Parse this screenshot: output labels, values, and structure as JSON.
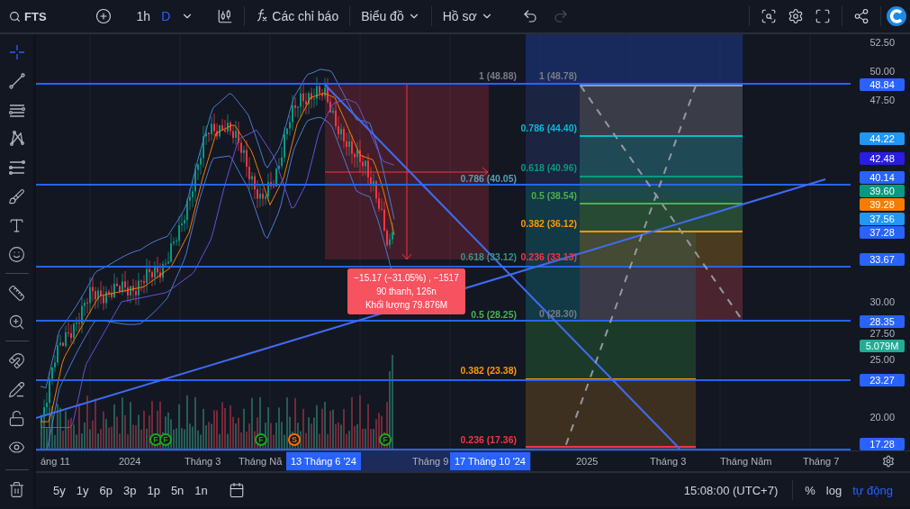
{
  "toolbar": {
    "symbol": "FTS",
    "intervals": [
      {
        "label": "1h",
        "selected": false
      },
      {
        "label": "D",
        "selected": true
      }
    ],
    "indicators_label": "Các chỉ báo",
    "chart_menu": "Biểu đồ",
    "profile_menu": "Hồ sơ",
    "redo_disabled": true
  },
  "drawing_tools": [
    {
      "kind": "crosshair",
      "selected": true
    },
    {
      "kind": "trend",
      "selected": false
    },
    {
      "kind": "channel",
      "selected": false
    },
    {
      "kind": "pattern",
      "selected": false
    },
    {
      "kind": "fib",
      "selected": false
    },
    {
      "kind": "brush",
      "selected": false
    },
    {
      "kind": "text",
      "selected": false
    },
    {
      "kind": "emoji",
      "selected": false
    },
    {
      "kind": "ruler",
      "selected": false
    },
    {
      "kind": "zoom",
      "selected": false
    },
    {
      "kind": "magnet",
      "selected": false
    },
    {
      "kind": "lockdraw",
      "selected": false
    },
    {
      "kind": "lock",
      "selected": false
    },
    {
      "kind": "eye",
      "selected": false
    }
  ],
  "price_axis": {
    "ticks": [
      "52.50",
      "50.00",
      "47.50",
      "30.00",
      "27.50",
      "25.00",
      "20.00"
    ],
    "badges": [
      {
        "value": "48.84",
        "color": "#2962ff"
      },
      {
        "value": "44.22",
        "color": "#2196f3"
      },
      {
        "value": "42.48",
        "color": "#2a1de0"
      },
      {
        "value": "40.14",
        "color": "#2962ff"
      },
      {
        "value": "39.60",
        "color": "#089981"
      },
      {
        "value": "39.28",
        "color": "#f57c00"
      },
      {
        "value": "37.56",
        "color": "#2196f3"
      },
      {
        "value": "37.28",
        "color": "#2962ff"
      },
      {
        "value": "33.67",
        "color": "#2962ff"
      },
      {
        "value": "28.35",
        "color": "#2962ff"
      },
      {
        "value": "5.079M",
        "color": "#22ab94"
      },
      {
        "value": "23.27",
        "color": "#2962ff"
      },
      {
        "value": "17.28",
        "color": "#2962ff"
      }
    ]
  },
  "fib_labels": [
    {
      "text": "1 (48.88)",
      "color": "#787b86"
    },
    {
      "text": "0.786 (40.05)",
      "color": "#5b9cb6"
    },
    {
      "text": "0.618 (33.12)",
      "color": "#3d8f86"
    },
    {
      "text": "0.5 (28.25)",
      "color": "#4caf50"
    },
    {
      "text": "0.382 (23.38)",
      "color": "#ff9800"
    },
    {
      "text": "0.236 (17.36)",
      "color": "#f23645"
    },
    {
      "text": "1 (48.78)",
      "color": "#787b86"
    },
    {
      "text": "0.786 (44.40)",
      "color": "#00bcd4"
    },
    {
      "text": "0.618 (40.96)",
      "color": "#089981"
    },
    {
      "text": "0.5 (38.54)",
      "color": "#4caf50"
    },
    {
      "text": "0.382 (36.12)",
      "color": "#ff9800"
    },
    {
      "text": "0.236 (33.13)",
      "color": "#f23645"
    },
    {
      "text": "0 (28.30)",
      "color": "#787b86"
    }
  ],
  "measure": {
    "lines": [
      "−15.17 (−31.05%) , −1517",
      "90 thanh, 126n",
      "Khối lượng 79.876M"
    ]
  },
  "event_markers": [
    {
      "label": "F",
      "color": "#1fa51f"
    },
    {
      "label": "F",
      "color": "#1fa51f"
    },
    {
      "label": "F",
      "color": "#1fa51f"
    },
    {
      "label": "S",
      "color": "#ff6d00"
    },
    {
      "label": "F",
      "color": "#1fa51f"
    }
  ],
  "time_axis": {
    "labels": [
      "áng 11",
      "2024",
      "Tháng 3",
      "Tháng Nă",
      "Tháng 9",
      "2025",
      "Tháng 3",
      "Tháng Năm",
      "Tháng 7"
    ],
    "range_start": "13 Tháng 6 '24",
    "range_end": "17 Tháng 10 '24"
  },
  "bottom_bar": {
    "ranges": [
      "5y",
      "1y",
      "6p",
      "3p",
      "1p",
      "5n",
      "1n"
    ],
    "time": "15:08:00 (UTC+7)",
    "percent": "%",
    "log": "log",
    "auto": {
      "label": "tự động",
      "selected": true
    }
  }
}
